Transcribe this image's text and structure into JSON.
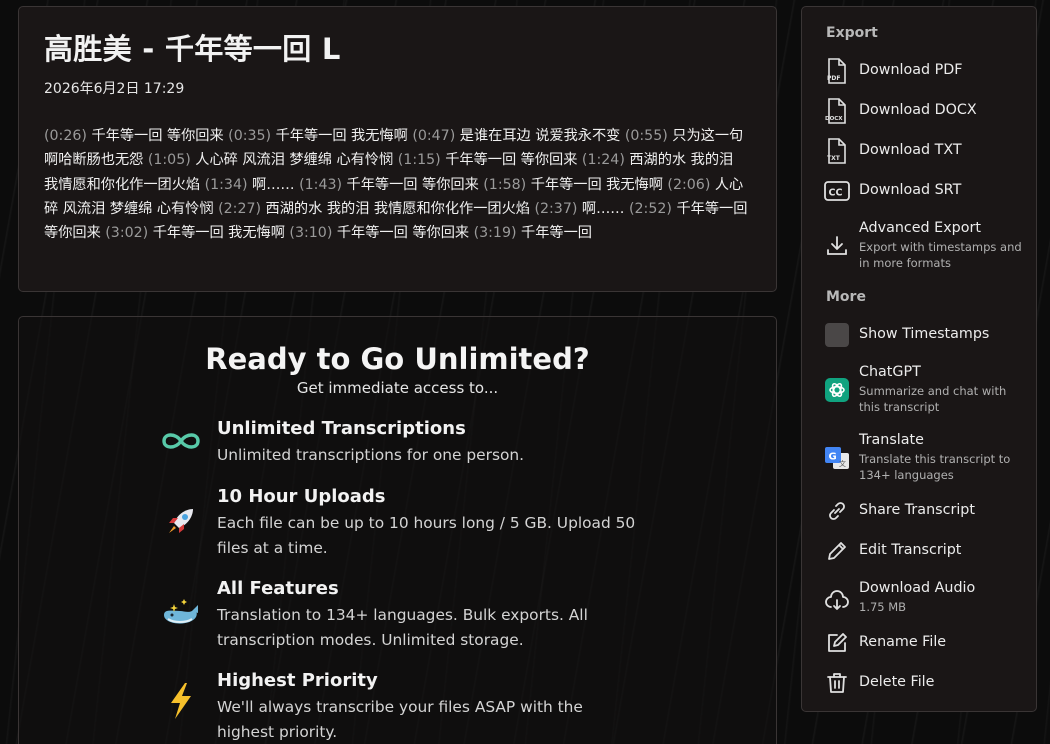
{
  "transcript": {
    "title": "高胜美 - 千年等一回 L",
    "date": "2026年6月2日 17:29",
    "segments": [
      {
        "ts": "(0:26)",
        "text": " 千年等一回 等你回来 "
      },
      {
        "ts": "(0:35)",
        "text": " 千年等一回 我无悔啊 "
      },
      {
        "ts": "(0:47)",
        "text": " 是谁在耳边 说爱我永不变 "
      },
      {
        "ts": "(0:55)",
        "text": " 只为这一句 啊哈断肠也无怨 "
      },
      {
        "ts": "(1:05)",
        "text": " 人心碎 风流泪 梦缠绵 心有怜悯 "
      },
      {
        "ts": "(1:15)",
        "text": " 千年等一回 等你回来 "
      },
      {
        "ts": "(1:24)",
        "text": " 西湖的水 我的泪 我情愿和你化作一团火焰 "
      },
      {
        "ts": "(1:34)",
        "text": " 啊…… "
      },
      {
        "ts": "(1:43)",
        "text": " 千年等一回 等你回来 "
      },
      {
        "ts": "(1:58)",
        "text": " 千年等一回 我无悔啊 "
      },
      {
        "ts": "(2:06)",
        "text": " 人心碎 风流泪 梦缠绵 心有怜悯 "
      },
      {
        "ts": "(2:27)",
        "text": " 西湖的水 我的泪 我情愿和你化作一团火焰 "
      },
      {
        "ts": "(2:37)",
        "text": " 啊…… "
      },
      {
        "ts": "(2:52)",
        "text": " 千年等一回 等你回来 "
      },
      {
        "ts": "(3:02)",
        "text": " 千年等一回 我无悔啊 "
      },
      {
        "ts": "(3:10)",
        "text": " 千年等一回 等你回来 "
      },
      {
        "ts": "(3:19)",
        "text": " 千年等一回"
      }
    ]
  },
  "upsell": {
    "heading": "Ready to Go Unlimited?",
    "subheading": "Get immediate access to...",
    "features": [
      {
        "icon": "infinity-icon",
        "title": "Unlimited Transcriptions",
        "desc": "Unlimited transcriptions for one person."
      },
      {
        "icon": "rocket-icon",
        "title": "10 Hour Uploads",
        "desc": "Each file can be up to 10 hours long / 5 GB. Upload 50 files at a time."
      },
      {
        "icon": "whale-icon",
        "title": "All Features",
        "desc": "Translation to 134+ languages. Bulk exports. All transcription modes. Unlimited storage."
      },
      {
        "icon": "lightning-icon",
        "title": "Highest Priority",
        "desc": "We'll always transcribe your files ASAP with the highest priority."
      }
    ]
  },
  "sidebar": {
    "export_heading": "Export",
    "more_heading": "More",
    "export_items": [
      {
        "icon": "pdf-file-icon",
        "label": "Download PDF"
      },
      {
        "icon": "docx-file-icon",
        "label": "Download DOCX"
      },
      {
        "icon": "txt-file-icon",
        "label": "Download TXT"
      },
      {
        "icon": "cc-icon",
        "label": "Download SRT"
      },
      {
        "icon": "download-icon",
        "label": "Advanced Export",
        "desc": "Export with timestamps and in more formats"
      }
    ],
    "more_items": [
      {
        "icon": "checkbox-icon",
        "label": "Show Timestamps"
      },
      {
        "icon": "chatgpt-icon",
        "label": "ChatGPT",
        "desc": "Summarize and chat with this transcript"
      },
      {
        "icon": "google-translate-icon",
        "label": "Translate",
        "desc": "Translate this transcript to 134+ languages"
      },
      {
        "icon": "link-icon",
        "label": "Share Transcript"
      },
      {
        "icon": "pencil-icon",
        "label": "Edit Transcript"
      },
      {
        "icon": "cloud-download-icon",
        "label": "Download Audio",
        "desc": "1.75 MB"
      },
      {
        "icon": "rename-icon",
        "label": "Rename File"
      },
      {
        "icon": "trash-icon",
        "label": "Delete File"
      }
    ]
  },
  "colors": {
    "accent_infinity": "#58c9a8",
    "chatgpt_green": "#10a37f",
    "translate_blue": "#4285f4"
  }
}
